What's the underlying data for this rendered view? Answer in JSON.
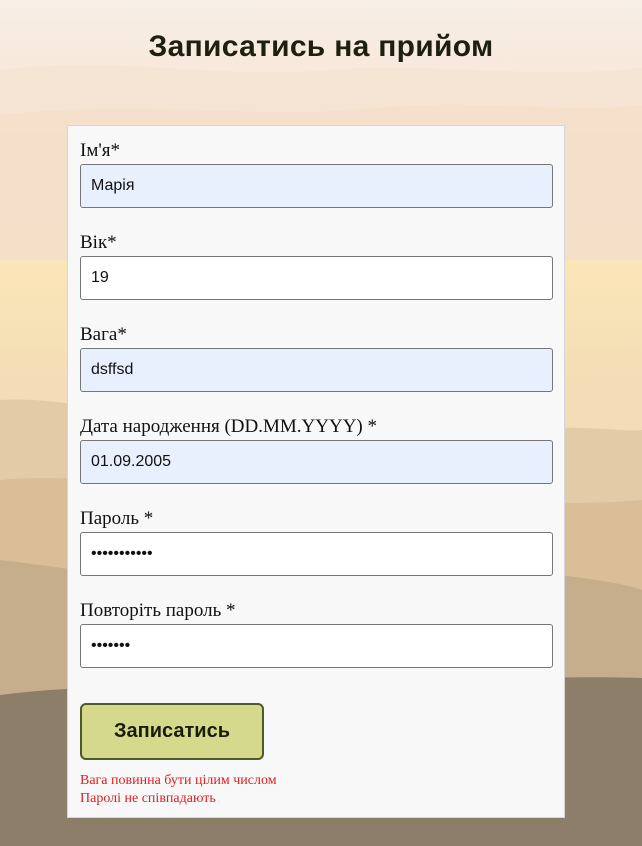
{
  "page": {
    "title": "Записатись на прийом"
  },
  "form": {
    "fields": [
      {
        "label": "Ім'я*",
        "value": "Марія",
        "type": "text",
        "autofill": true
      },
      {
        "label": "Вік*",
        "value": "19",
        "type": "text",
        "autofill": false
      },
      {
        "label": "Вага*",
        "value": "dsffsd",
        "type": "text",
        "autofill": true
      },
      {
        "label": "Дата народження (DD.MM.YYYY) *",
        "value": "01.09.2005",
        "type": "text",
        "autofill": true
      },
      {
        "label": "Пароль *",
        "value": "•••••••••••",
        "type": "password",
        "autofill": false
      },
      {
        "label": "Повторіть пароль *",
        "value": "•••••••",
        "type": "password",
        "autofill": false
      }
    ],
    "submit_label": "Записатись",
    "errors": [
      "Вага повинна бути цілим числом",
      "Паролі не співпадають"
    ]
  },
  "colors": {
    "card_bg": "#f8f8f8",
    "button_bg": "#d4d98b",
    "button_border": "#4f5a26",
    "error_text": "#e01e1e",
    "autofill_bg": "#e8f0fe"
  }
}
